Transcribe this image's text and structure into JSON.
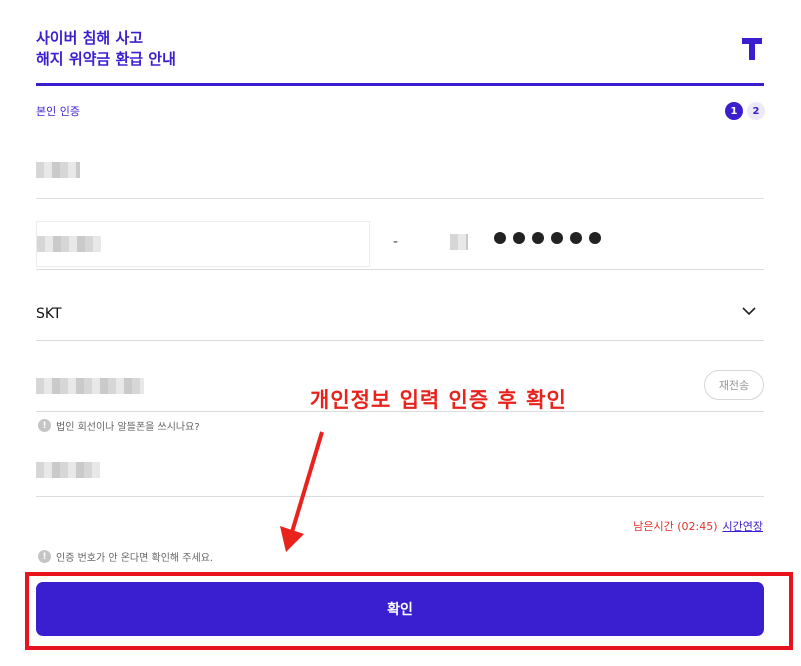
{
  "header": {
    "title_line1": "사이버 침해 사고",
    "title_line2": "해지 위약금 환급 안내",
    "logo_icon": "t-logo-icon",
    "brand_color": "#3a1fd1"
  },
  "auth": {
    "section_label": "본인 인증",
    "steps": [
      "1",
      "2"
    ],
    "active_step": 1
  },
  "form": {
    "rrn_separator": "-",
    "masked_digits": 6,
    "carrier": "SKT",
    "resend_label": "재전송",
    "corporate_hint": "법인 회선이나 알뜰폰을 쓰시나요?",
    "timer_remaining": "남은시간 (02:45)",
    "timer_extend": "시간연장",
    "code_hint": "인증 번호가 안 온다면 확인해 주세요."
  },
  "annotation": {
    "text": "개인정보 입력 인증 후 확인",
    "color": "#e8231d"
  },
  "confirm_button": {
    "label": "확인"
  }
}
